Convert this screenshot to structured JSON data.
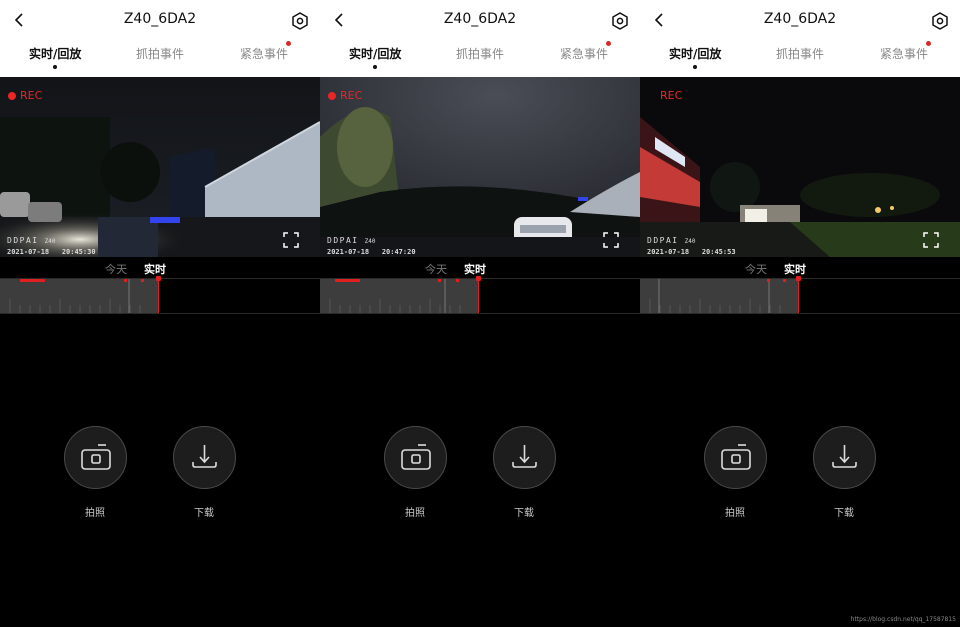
{
  "panels": [
    {
      "title": "Z40_6DA2",
      "tabs": [
        "实时/回放",
        "抓拍事件",
        "紧急事件"
      ],
      "rec": "REC",
      "watermark": {
        "brand": "DDPAI",
        "model": "Z40",
        "date": "2021-07-18",
        "time": "20:45:30"
      },
      "timeline": {
        "today": "今天",
        "live": "实时"
      },
      "buttons": {
        "snap": "拍照",
        "download": "下载"
      }
    },
    {
      "title": "Z40_6DA2",
      "tabs": [
        "实时/回放",
        "抓拍事件",
        "紧急事件"
      ],
      "rec": "REC",
      "watermark": {
        "brand": "DDPAI",
        "model": "Z40",
        "date": "2021-07-18",
        "time": "20:47:20"
      },
      "timeline": {
        "today": "今天",
        "live": "实时"
      },
      "buttons": {
        "snap": "拍照",
        "download": "下载"
      }
    },
    {
      "title": "Z40_6DA2",
      "tabs": [
        "实时/回放",
        "抓拍事件",
        "紧急事件"
      ],
      "rec": "REC",
      "watermark": {
        "brand": "DDPAI",
        "model": "Z40",
        "date": "2021-07-18",
        "time": "20:45:53"
      },
      "timeline": {
        "today": "今天",
        "live": "实时"
      },
      "buttons": {
        "snap": "拍照",
        "download": "下载"
      }
    }
  ],
  "credit": "https://blog.csdn.net/qq_17587815",
  "colors": {
    "rec": "#e82626",
    "badge": "#d62a2a",
    "header_bg": "#ffffff",
    "app_bg": "#000000"
  }
}
